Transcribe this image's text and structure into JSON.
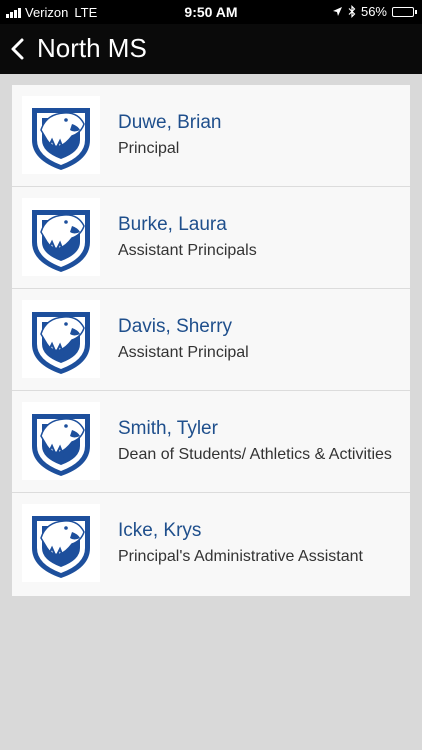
{
  "status": {
    "carrier": "Verizon",
    "network": "LTE",
    "time": "9:50 AM",
    "battery": "56%",
    "battery_level": 0.56
  },
  "nav": {
    "title": "North MS",
    "back_icon": "chevron-left-icon"
  },
  "staff": [
    {
      "name": "Duwe, Brian",
      "title": "Principal"
    },
    {
      "name": "Burke, Laura",
      "title": "Assistant Principals"
    },
    {
      "name": "Davis, Sherry",
      "title": "Assistant Principal"
    },
    {
      "name": "Smith, Tyler",
      "title": "Dean of Students/ Athletics & Activities"
    },
    {
      "name": "Icke, Krys",
      "title": "Principal's Administrative Assistant"
    }
  ],
  "colors": {
    "name_text": "#1f4f8c",
    "logo_blue": "#1d4f9c",
    "nav_bg": "#0a0a0a",
    "page_bg": "#d9d9d9"
  }
}
